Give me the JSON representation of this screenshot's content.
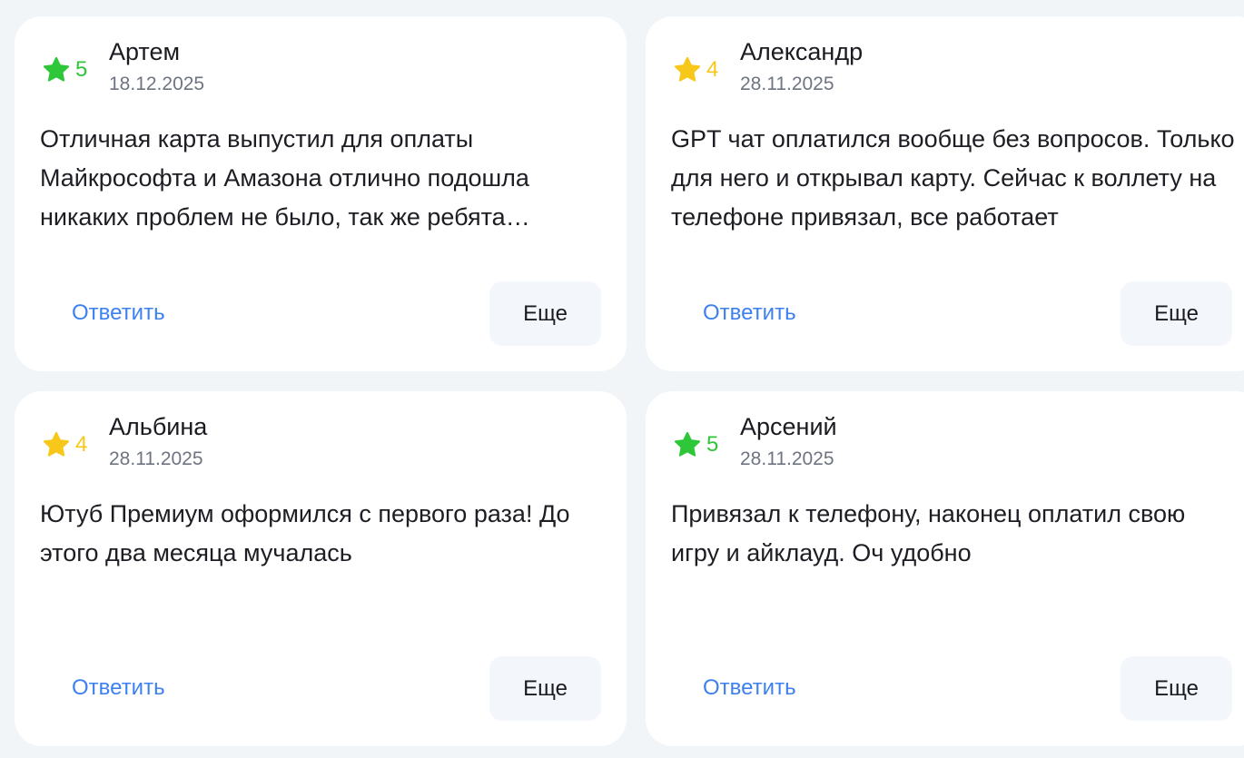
{
  "colors": {
    "page_bg": "#f2f5f8",
    "card_bg": "#ffffff",
    "rating_high": "#2fc73a",
    "rating_mid": "#f7c71a",
    "link": "#3d80ef",
    "button_bg": "#f3f6fb"
  },
  "reviews": [
    {
      "rating": "5",
      "rating_color": "green",
      "star_icon": "star-icon",
      "author": "Артем",
      "date": "18.12.2025",
      "text": "Отличная карта выпустил для оплаты Майкрософта и Амазона отлично подошла никаких проблем не было, так же ребята помогли разобраться",
      "reply_label": "Ответить",
      "more_label": "Еще"
    },
    {
      "rating": "4",
      "rating_color": "yellow",
      "star_icon": "star-icon",
      "author": "Александр",
      "date": "28.11.2025",
      "text": "GPT чат оплатился вообще без вопросов. Только для него и открывал карту. Сейчас к воллету на телефоне привязал, все работает",
      "reply_label": "Ответить",
      "more_label": "Еще"
    },
    {
      "rating": "4",
      "rating_color": "yellow",
      "star_icon": "star-icon",
      "author": "Альбина",
      "date": "28.11.2025",
      "text": "Ютуб Премиум оформился с первого раза! До этого два месяца мучалась",
      "reply_label": "Ответить",
      "more_label": "Еще"
    },
    {
      "rating": "5",
      "rating_color": "green",
      "star_icon": "star-icon",
      "author": "Арсений",
      "date": "28.11.2025",
      "text": "Привязал к телефону, наконец оплатил свою игру и айклауд. Оч удобно",
      "reply_label": "Ответить",
      "more_label": "Еще"
    }
  ]
}
